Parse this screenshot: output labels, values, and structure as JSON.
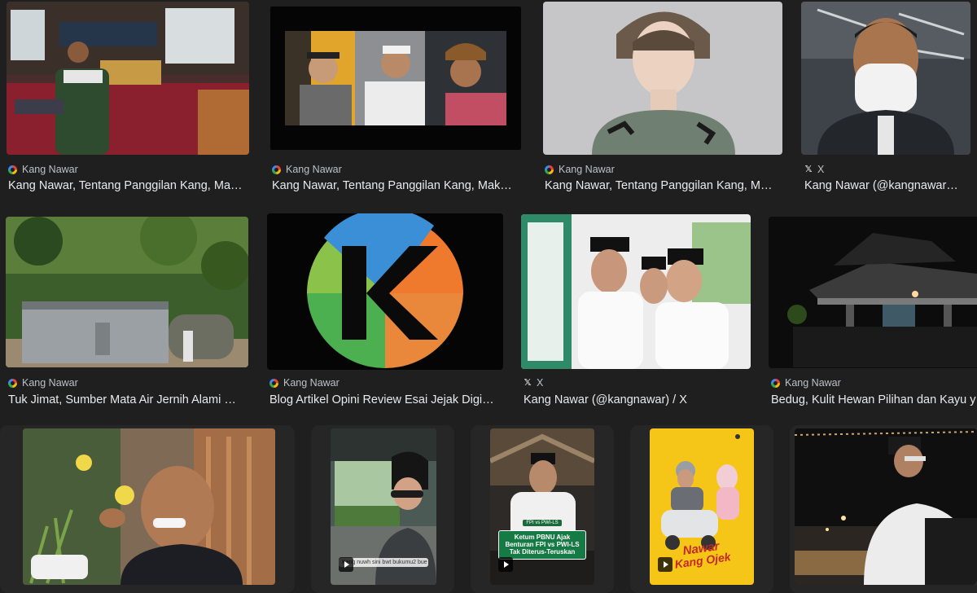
{
  "results": [
    {
      "source": "Kang Nawar",
      "source_icon": "google-icon",
      "title": "Kang Nawar, Tentang Panggilan Kang, Ma…"
    },
    {
      "source": "Kang Nawar",
      "source_icon": "google-icon",
      "title": "Kang Nawar, Tentang Panggilan Kang, Mak…"
    },
    {
      "source": "Kang Nawar",
      "source_icon": "google-icon",
      "title": "Kang Nawar, Tentang Panggilan Kang, M…"
    },
    {
      "source": "X",
      "source_icon": "x-icon",
      "title": "Kang Nawar (@kangnawar…"
    },
    {
      "source": "Kang Nawar",
      "source_icon": "google-icon",
      "title": "Tuk Jimat, Sumber Mata Air Jernih Alami …"
    },
    {
      "source": "Kang Nawar",
      "source_icon": "google-icon",
      "title": "Blog Artikel Opini Review Esai Jejak Digi…"
    },
    {
      "source": "X",
      "source_icon": "x-icon",
      "title": "Kang Nawar (@kangnawar) / X"
    },
    {
      "source": "Kang Nawar",
      "source_icon": "google-icon",
      "title": "Bedug, Kulit Hewan Pilihan dan Kayu y"
    }
  ],
  "videos": [
    {
      "caption": "Kang nuwh sini bwt bukumu2 bue yt"
    },
    {
      "overlay_tag": "FPI vs PWI-LS",
      "overlay_text": "Ketum PBNU Ajak Benturan FPI vs PWI-LS Tak Diterus-Teruskan"
    },
    {
      "overlay_title_1": "Nawar",
      "overlay_title_2": "Kang Ojek"
    }
  ],
  "colors": {
    "background": "#1f1f1f",
    "title_text": "#e8eaed",
    "source_text": "#bdc1c6"
  }
}
